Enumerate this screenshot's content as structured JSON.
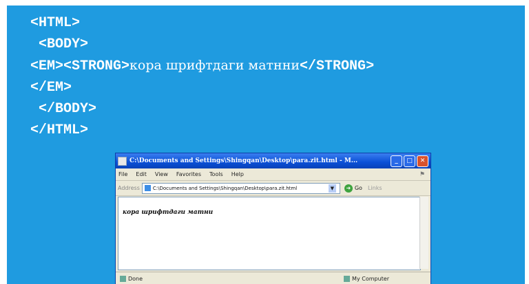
{
  "code_lines": [
    {
      "text": "<HTML>"
    },
    {
      "text": " <BODY>"
    },
    {
      "prefix": "<EM><STRONG>",
      "cyrillic": "кора шрифтдаги матнни",
      "suffix": "</STRONG>"
    },
    {
      "text": "</EM>"
    },
    {
      "text": " </BODY>"
    },
    {
      "text": "</HTML>"
    }
  ],
  "browser": {
    "title": "C:\\Documents and Settings\\Shingqan\\Desktop\\para.zit.html - M...",
    "window_buttons": {
      "minimize": "_",
      "maximize": "□",
      "close": "✕"
    },
    "menu": [
      "File",
      "Edit",
      "View",
      "Favorites",
      "Tools",
      "Help"
    ],
    "address_label": "Address",
    "address_value": "C:\\Documents and Settings\\Shingqan\\Desktop\\para.zit.html",
    "go_label": "Go",
    "links_label": "Links",
    "content_text": "кора шрифтдаги матни",
    "status_left": "Done",
    "status_right": "My Computer"
  },
  "colors": {
    "slide_background": "#1f9be0",
    "titlebar": "#0a4fd6"
  }
}
